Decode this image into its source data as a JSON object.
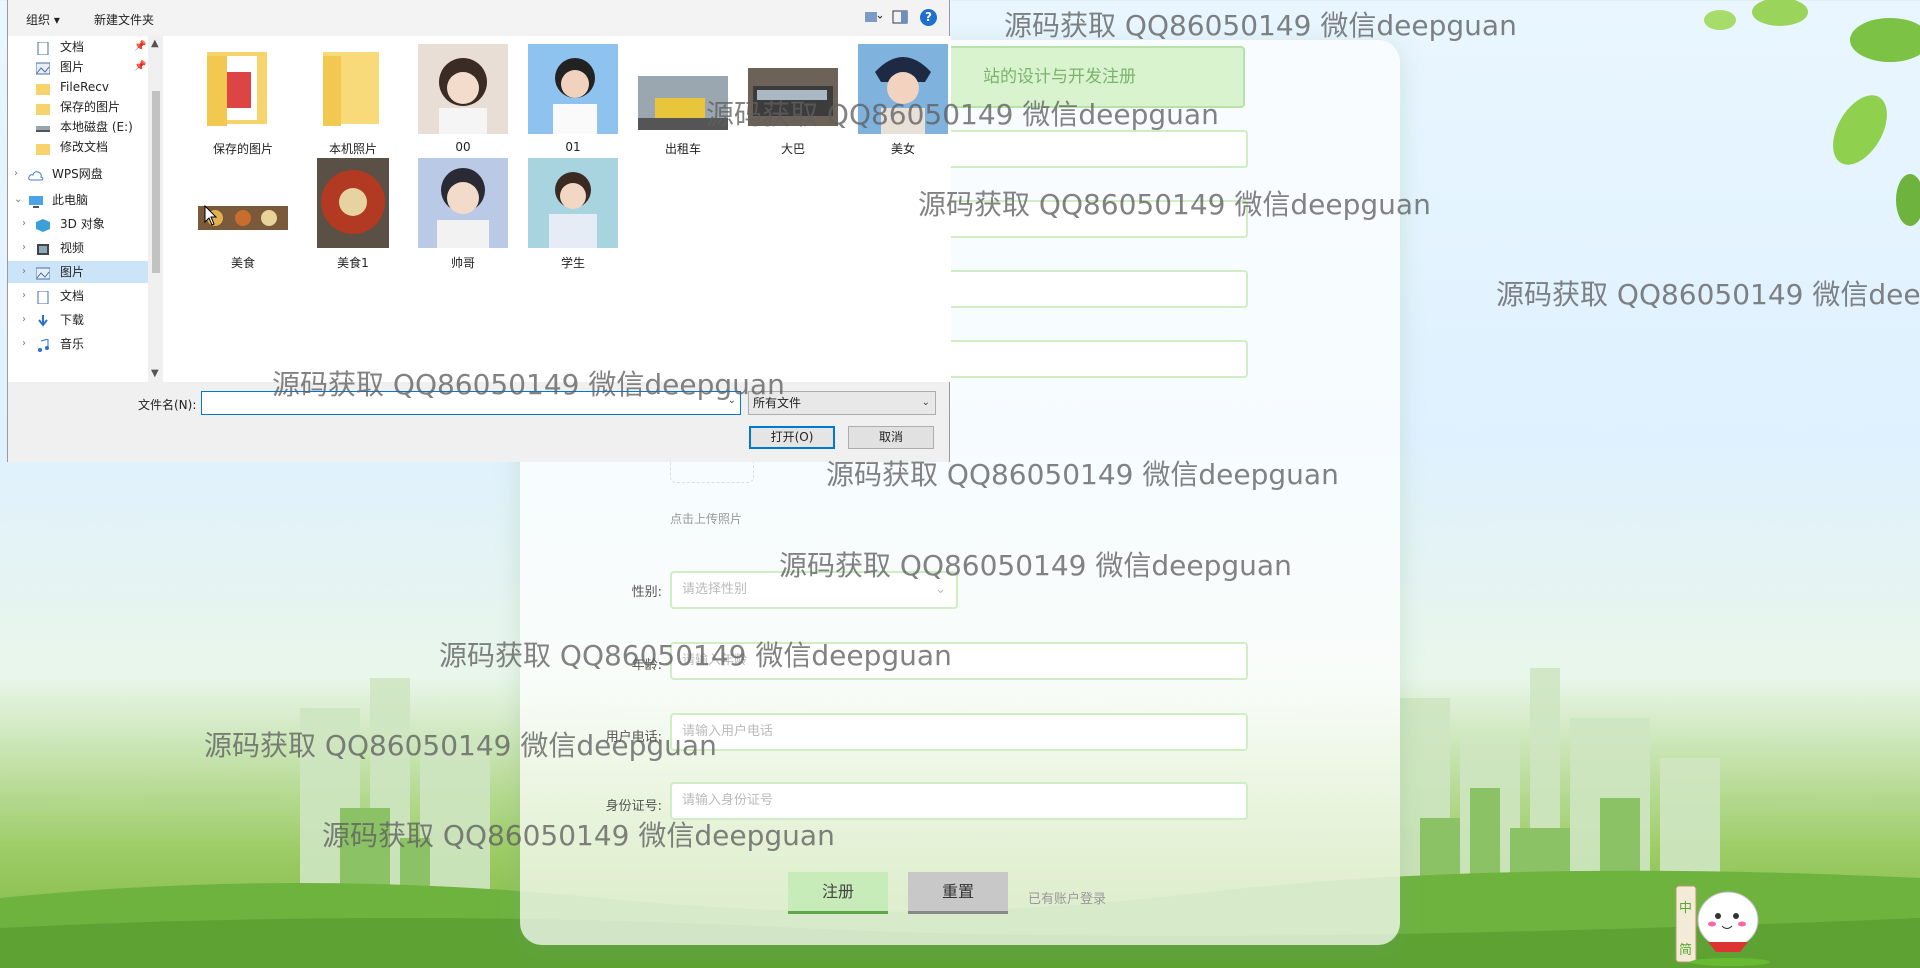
{
  "registration": {
    "title_partial": "站的设计与开发注册",
    "photo_upload_tip": "点击上传照片",
    "fields": [
      {
        "label": "性别:",
        "placeholder": "请选择性别",
        "type": "select"
      },
      {
        "label": "年龄:",
        "placeholder": "请输入年龄",
        "type": "input"
      },
      {
        "label": "用户电话:",
        "placeholder": "请输入用户电话",
        "type": "input"
      },
      {
        "label": "身份证号:",
        "placeholder": "请输入身份证号",
        "type": "input"
      }
    ],
    "register_button": "注册",
    "reset_button": "重置",
    "login_link": "已有账户登录"
  },
  "mascot_text": "中 简",
  "watermark": "源码获取 QQ86050149 微信deepguan",
  "dialog": {
    "toolbar": {
      "organize": "组织",
      "new_folder": "新建文件夹",
      "help": "?"
    },
    "nav": [
      {
        "label": "文档",
        "pinned": true,
        "icon": "document-icon"
      },
      {
        "label": "图片",
        "pinned": true,
        "icon": "picture-icon"
      },
      {
        "label": "FileRecv",
        "icon": "folder-icon"
      },
      {
        "label": "保存的图片",
        "icon": "folder-icon"
      },
      {
        "label": "本地磁盘 (E:)",
        "icon": "drive-icon"
      },
      {
        "label": "修改文档",
        "icon": "folder-icon"
      },
      {
        "label": "WPS网盘",
        "icon": "cloud-icon"
      },
      {
        "label": "此电脑",
        "icon": "computer-icon"
      },
      {
        "label": "3D 对象",
        "icon": "cube-icon"
      },
      {
        "label": "视频",
        "icon": "video-icon"
      },
      {
        "label": "图片",
        "icon": "picture-icon",
        "selected": true
      },
      {
        "label": "文档",
        "icon": "document-icon"
      },
      {
        "label": "下载",
        "icon": "download-icon"
      },
      {
        "label": "音乐",
        "icon": "music-icon"
      }
    ],
    "files": [
      {
        "name": "保存的图片",
        "kind": "folder"
      },
      {
        "name": "本机照片",
        "kind": "folder"
      },
      {
        "name": "00",
        "kind": "image"
      },
      {
        "name": "01",
        "kind": "image"
      },
      {
        "name": "出租车",
        "kind": "image"
      },
      {
        "name": "大巴",
        "kind": "image"
      },
      {
        "name": "美女",
        "kind": "image"
      },
      {
        "name": "美食",
        "kind": "image"
      },
      {
        "name": "美食1",
        "kind": "image"
      },
      {
        "name": "帅哥",
        "kind": "image"
      },
      {
        "name": "学生",
        "kind": "image"
      }
    ],
    "filename_label": "文件名(N):",
    "filename_value": "",
    "filetype": "所有文件",
    "open_button": "打开(O)",
    "cancel_button": "取消"
  }
}
